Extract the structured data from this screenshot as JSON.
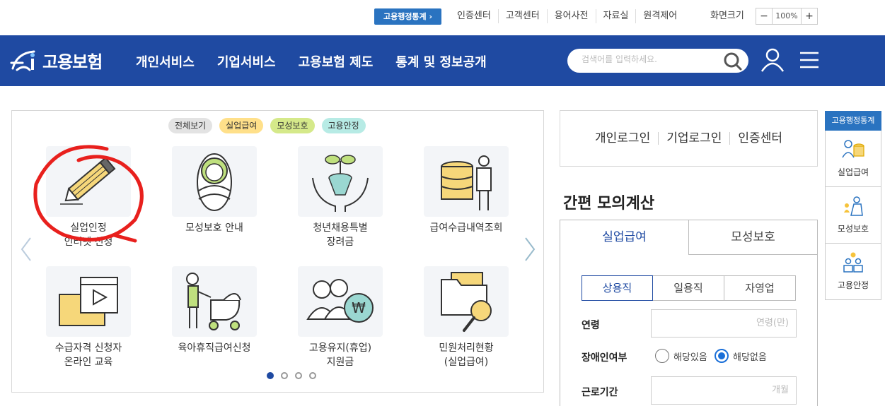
{
  "util": {
    "badge": "고용행정통계 ›",
    "links": [
      "인증센터",
      "고객센터",
      "용어사전",
      "자료실",
      "원격제어"
    ],
    "zoom_label": "화면크기",
    "zoom_minus": "−",
    "zoom_value": "100%",
    "zoom_plus": "+"
  },
  "header": {
    "logo_text": "고용보험",
    "nav": [
      "개인서비스",
      "기업서비스",
      "고용보험 제도",
      "통계 및 정보공개"
    ],
    "search_placeholder": "검색어를 입력하세요."
  },
  "panel": {
    "categories": [
      "전체보기",
      "실업급여",
      "모성보호",
      "고용안정"
    ],
    "tiles": [
      {
        "label": "실업인정\n인터넷 신청",
        "icon": "pencil-icon"
      },
      {
        "label": "모성보호 안내",
        "icon": "baby-icon"
      },
      {
        "label": "청년채용특별\n장려금",
        "icon": "sprout-hands-icon"
      },
      {
        "label": "급여수급내역조회",
        "icon": "coins-person-icon"
      },
      {
        "label": "수급자격 신청자\n온라인 교육",
        "icon": "video-play-icon"
      },
      {
        "label": "육아휴직급여신청",
        "icon": "stroller-icon"
      },
      {
        "label": "고용유지(휴업)\n지원금",
        "icon": "people-won-icon"
      },
      {
        "label": "민원처리현황\n(실업급여)",
        "icon": "folder-search-icon"
      }
    ]
  },
  "login": {
    "items": [
      "개인로그인",
      "기업로그인",
      "인증센터"
    ]
  },
  "calc": {
    "title": "간편 모의계산",
    "tabs": [
      "실업급여",
      "모성보호"
    ],
    "subtabs": [
      "상용직",
      "일용직",
      "자영업"
    ],
    "age_label": "연령",
    "age_placeholder": "연령(만)",
    "disability_label": "장애인여부",
    "disability_yes": "해당있음",
    "disability_no": "해당없음",
    "period_label": "근로기간",
    "period_placeholder": "개월"
  },
  "side": {
    "head": "고용행정통계",
    "items": [
      "실업급여",
      "모성보호",
      "고용안정"
    ]
  },
  "colors": {
    "brand": "#1f4aa2",
    "accent": "#2a73c0"
  }
}
